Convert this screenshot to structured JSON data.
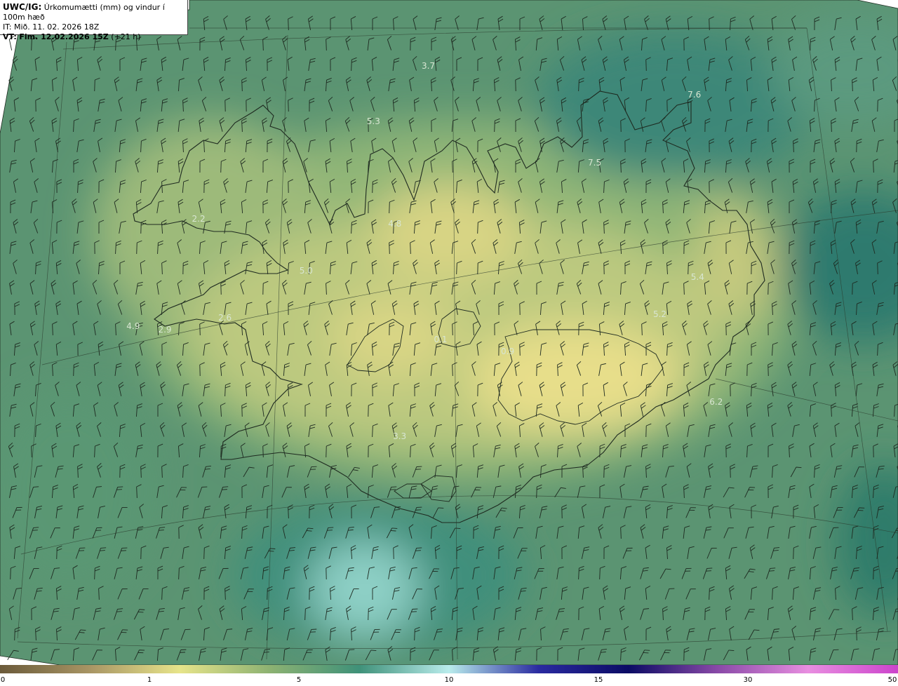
{
  "header": {
    "product": "UWC/IG:",
    "title": "Úrkomumætti (mm) og vindur í 100m hæð",
    "issue_label": "IT:",
    "issue_time": "Mið. 11. 02. 2026 18Z",
    "valid_label": "VT:",
    "valid_time": "Fim. 12.02.2026 15Z",
    "lead_time": "(+21 h)"
  },
  "field_values": [
    {
      "text": "3.7",
      "lon": -19.06,
      "lat": 67.96
    },
    {
      "text": "7.6",
      "lon": -11.95,
      "lat": 67.63
    },
    {
      "text": "5.3",
      "lon": -20.49,
      "lat": 67.32
    },
    {
      "text": "7.5",
      "lon": -14.74,
      "lat": 66.83
    },
    {
      "text": "2.2",
      "lon": -24.8,
      "lat": 66.18
    },
    {
      "text": "4.8",
      "lon": -19.86,
      "lat": 66.12
    },
    {
      "text": "5.0",
      "lon": -22.01,
      "lat": 65.57
    },
    {
      "text": "5.4",
      "lon": -12.41,
      "lat": 65.5
    },
    {
      "text": "5.2",
      "lon": -13.42,
      "lat": 65.06
    },
    {
      "text": "4.9",
      "lon": -26.07,
      "lat": 64.92
    },
    {
      "text": "2.9",
      "lon": -25.3,
      "lat": 64.88
    },
    {
      "text": "2.6",
      "lon": -23.89,
      "lat": 65.02
    },
    {
      "text": "0.1",
      "lon": -18.7,
      "lat": 64.77
    },
    {
      "text": "0.9",
      "lon": -17.11,
      "lat": 64.63
    },
    {
      "text": "6.2",
      "lon": -12.3,
      "lat": 64.04
    },
    {
      "text": "3.3",
      "lon": -19.63,
      "lat": 63.64
    }
  ],
  "colorbar": {
    "ticks": [
      "0",
      "1",
      "5",
      "10",
      "15",
      "30",
      "50"
    ],
    "colors": [
      "#6b5a3a",
      "#a89564",
      "#e7e48a",
      "#8db272",
      "#3f9179",
      "#b9ecec",
      "#2a2aa0",
      "#0b0b64",
      "#8a4aa8",
      "#e88ee0",
      "#cc44cc"
    ]
  },
  "colors": {
    "land_high": "#e6dc86",
    "land_mid": "#9fba78",
    "sea": "#5b9472",
    "teal": "#3e8a7b",
    "coast": "#1e2a20",
    "barb": "#1e2a20"
  }
}
